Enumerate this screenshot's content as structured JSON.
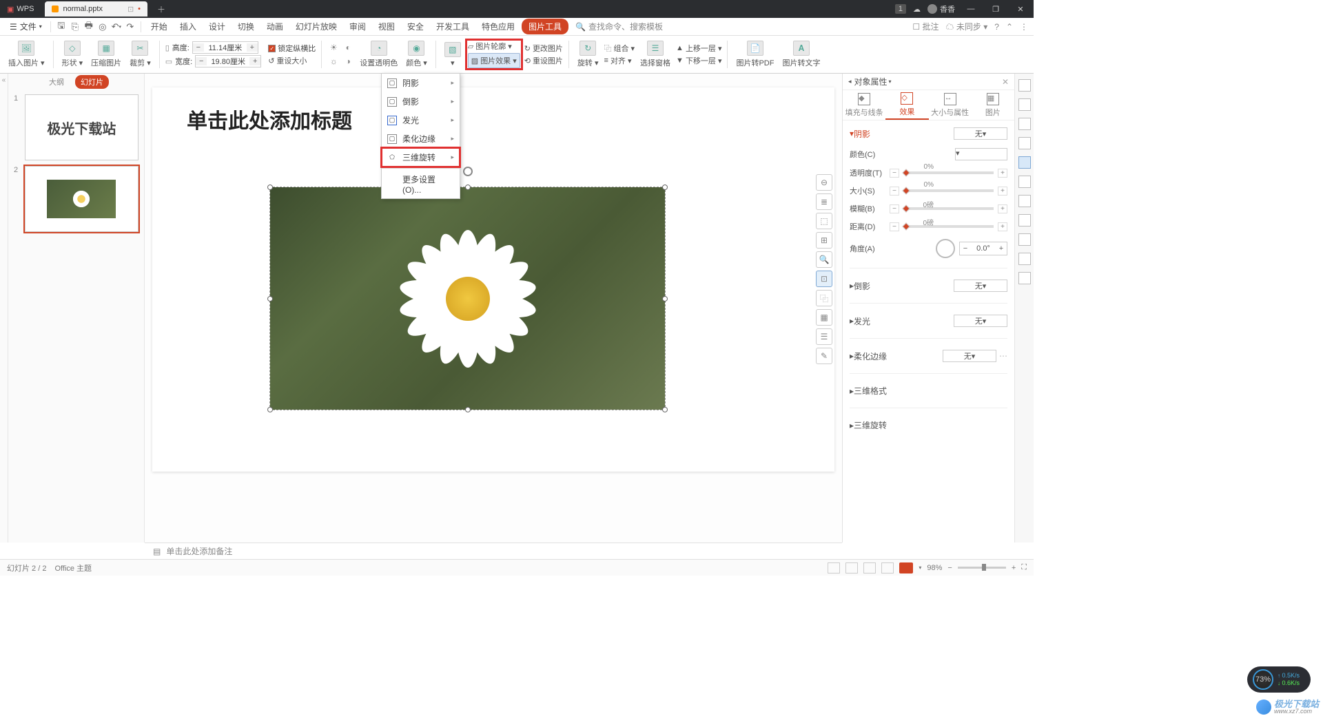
{
  "titlebar": {
    "app": "WPS",
    "filename": "normal.pptx",
    "user": "香香",
    "badge": "1"
  },
  "menubar": {
    "file": "文件",
    "items": [
      "开始",
      "插入",
      "设计",
      "切换",
      "动画",
      "幻灯片放映",
      "审阅",
      "视图",
      "安全",
      "开发工具",
      "特色应用",
      "图片工具"
    ],
    "search_cmd": "查找命令、搜索模板",
    "comments": "批注",
    "sync": "未同步"
  },
  "ribbon": {
    "insert_pic": "插入图片",
    "shape": "形状",
    "compress": "压缩图片",
    "crop": "裁剪",
    "height_lbl": "高度:",
    "height_val": "11.14厘米",
    "width_lbl": "宽度:",
    "width_val": "19.80厘米",
    "lock_ratio": "锁定纵横比",
    "reset_size": "重设大小",
    "set_alpha": "设置透明色",
    "color": "颜色",
    "pic_outline": "图片轮廓",
    "pic_effects": "图片效果",
    "change_pic": "更改图片",
    "reset_pic": "重设图片",
    "rotate": "旋转",
    "group": "组合",
    "align": "对齐",
    "select_pane": "选择窗格",
    "bring_fwd": "上移一层",
    "send_back": "下移一层",
    "to_pdf": "图片转PDF",
    "to_text": "图片转文字"
  },
  "dropdown": {
    "shadow": "阴影",
    "reflection": "倒影",
    "glow": "发光",
    "soft_edges": "柔化边缘",
    "rotation_3d": "三维旋转",
    "more": "更多设置(O)..."
  },
  "thumbs": {
    "outline_tab": "大纲",
    "slides_tab": "幻灯片",
    "slide1_text": "极光下载站"
  },
  "slide": {
    "title_placeholder": "单击此处添加标题"
  },
  "properties": {
    "panel_title": "对象属性",
    "tab_fill": "填充与线条",
    "tab_effects": "效果",
    "tab_size": "大小与属性",
    "tab_picture": "图片",
    "shadow": "阴影",
    "none": "无",
    "color_lbl": "颜色(C)",
    "transparency_lbl": "透明度(T)",
    "transparency_val": "0%",
    "size_lbl": "大小(S)",
    "size_val": "0%",
    "blur_lbl": "模糊(B)",
    "blur_val": "0磅",
    "distance_lbl": "距离(D)",
    "distance_val": "0磅",
    "angle_lbl": "角度(A)",
    "angle_val": "0.0°",
    "reflection": "倒影",
    "glow": "发光",
    "soft_edges": "柔化边缘",
    "format_3d": "三维格式",
    "rotation_3d": "三维旋转"
  },
  "notes": {
    "placeholder": "单击此处添加备注"
  },
  "status": {
    "slide_pos": "幻灯片 2 / 2",
    "theme": "Office 主题",
    "zoom": "98%"
  },
  "netwidget": {
    "pct": "73%",
    "up": "0.5K/s",
    "down": "0.6K/s"
  },
  "watermark": {
    "text": "极光下载站",
    "url": "www.xz7.com"
  }
}
